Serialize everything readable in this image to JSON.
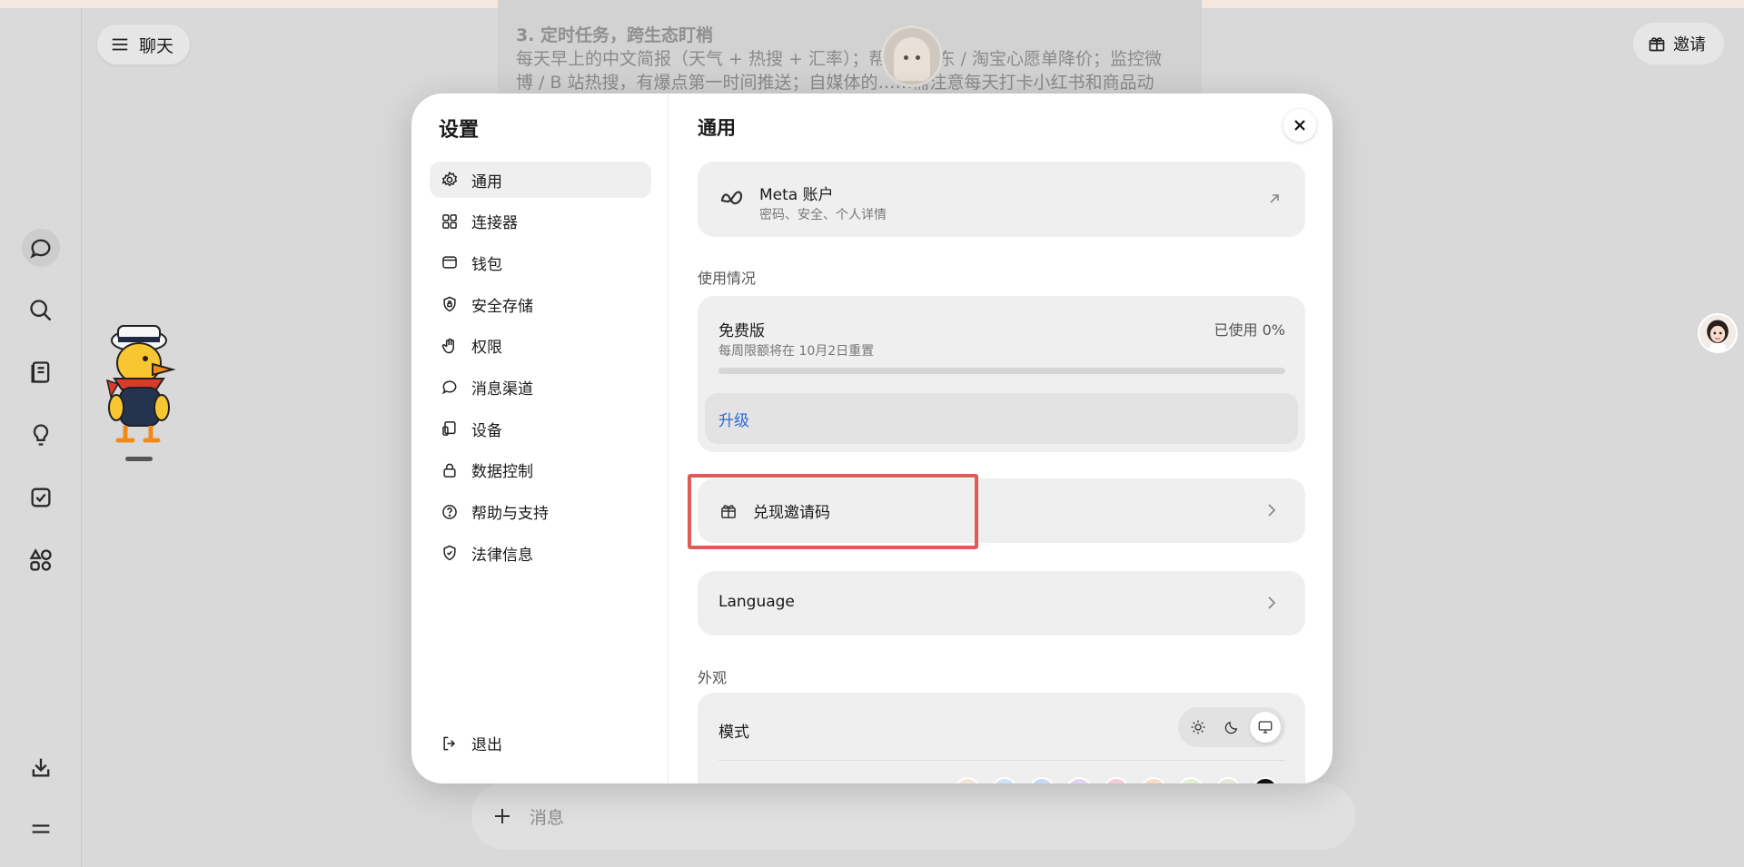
{
  "app": {
    "chat_button_label": "聊天",
    "invite_button_label": "邀请",
    "composer_placeholder": "消息",
    "background_text": {
      "heading": "3. 定时任务，跨生态盯梢",
      "line1": "每天早上的中文简报（天气 + 热搜 + 汇率）；帮我盯京东 / 淘宝心愿单降价；监控微",
      "line2": "博 / B 站热搜，有爆点第一时间推送；自媒体的……需注意每天打卡小红书和商品动"
    }
  },
  "settings": {
    "title": "设置",
    "nav": [
      {
        "label": "通用",
        "icon": "gear-icon",
        "active": true
      },
      {
        "label": "连接器",
        "icon": "grid-icon",
        "active": false
      },
      {
        "label": "钱包",
        "icon": "wallet-icon",
        "active": false
      },
      {
        "label": "安全存储",
        "icon": "shield-lock-icon",
        "active": false
      },
      {
        "label": "权限",
        "icon": "hand-icon",
        "active": false
      },
      {
        "label": "消息渠道",
        "icon": "chat-bubble-icon",
        "active": false
      },
      {
        "label": "设备",
        "icon": "devices-icon",
        "active": false
      },
      {
        "label": "数据控制",
        "icon": "lock-icon",
        "active": false
      },
      {
        "label": "帮助与支持",
        "icon": "help-icon",
        "active": false
      },
      {
        "label": "法律信息",
        "icon": "shield-check-icon",
        "active": false
      }
    ],
    "logout_label": "退出"
  },
  "general": {
    "title": "通用",
    "meta_account": {
      "title": "Meta 账户",
      "subtitle": "密码、安全、个人详情"
    },
    "usage_label": "使用情况",
    "plan": {
      "name": "免费版",
      "reset_note": "每周限额将在 10月2日重置",
      "used_text": "已使用 0%",
      "used_fraction": 0,
      "upgrade_label": "升级"
    },
    "redeem_label": "兑现邀请码",
    "language_label": "Language",
    "appearance_label": "外观",
    "mode_label": "模式",
    "mode_selected": "system",
    "accent_colors": [
      "#f3e6d6",
      "#cfe2f6",
      "#c6d8f8",
      "#e3d3f3",
      "#f7c9dc",
      "#f8dcc6",
      "#e3efd0",
      "#e9e6da",
      "#111111"
    ]
  },
  "colors": {
    "accent_link": "#2f6bd6",
    "highlight_box": "#e05a5a"
  }
}
